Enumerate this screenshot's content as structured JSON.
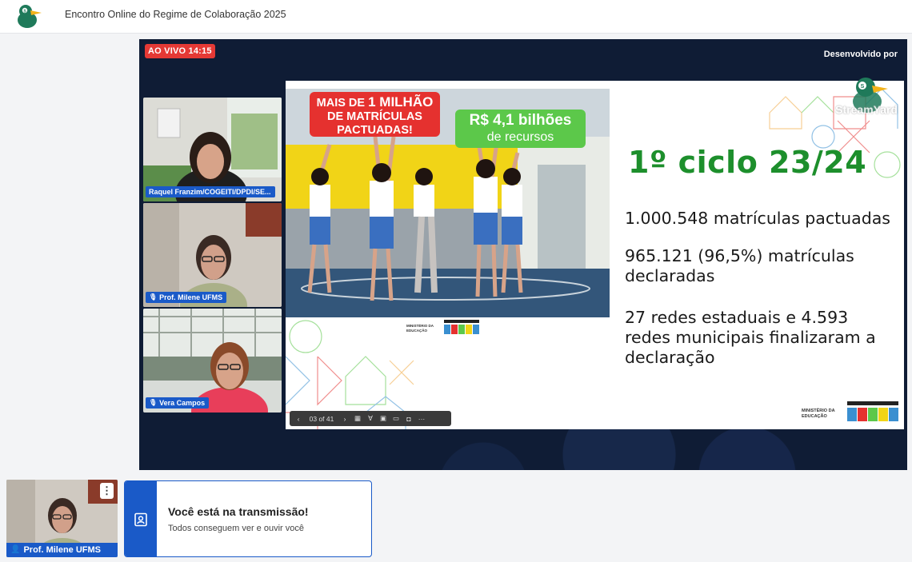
{
  "header": {
    "title": "Encontro Online do Regime de Colaboração 2025",
    "logo_icon": "duck-logo-icon"
  },
  "stage": {
    "live_badge": "AO VIVO 14:15",
    "developed_by": "Desenvolvido por",
    "watermark": "StreamYard",
    "participants": [
      {
        "name": "Raquel Franzim/COGEITI/DPDI/SE...",
        "mic": "mic-icon"
      },
      {
        "name": "Prof. Milene UFMS",
        "mic": "mic-icon"
      },
      {
        "name": "Vera Campos",
        "mic": "mic-icon"
      }
    ]
  },
  "slide": {
    "red_box_line1": "MAIS DE",
    "red_box_bold": "1 MILHÃO",
    "red_box_line2": "DE MATRÍCULAS",
    "red_box_line3": "PACTUADAS!",
    "green_box_line1": "R$ 4,1 bilhões",
    "green_box_line2": "de recursos",
    "heading": "1º ciclo 23/24",
    "p1": "1.000.548 matrículas pactuadas",
    "p2_line1": "965.121 (96,5%) matrículas",
    "p2_line2": "declaradas",
    "p3_line1": "27 redes estaduais e 4.593",
    "p3_line2": "redes municipais finalizaram a",
    "p3_line3": "declaração",
    "ministry_line1": "MINISTÉRIO DA",
    "ministry_line2": "EDUCAÇÃO",
    "toolbar": {
      "page_indicator": "03 of 41",
      "prev": "‹",
      "next": "›",
      "more": "···"
    }
  },
  "self_view": {
    "name": "Prof. Milene UFMS",
    "more": "⋮"
  },
  "notice": {
    "title": "Você está na transmissão!",
    "subtitle": "Todos conseguem ver e ouvir você"
  },
  "colors": {
    "accent_blue": "#1a5ac8",
    "live_red": "#e53935",
    "slide_green": "#1d8f2c",
    "stage_bg": "#0f1c35"
  }
}
